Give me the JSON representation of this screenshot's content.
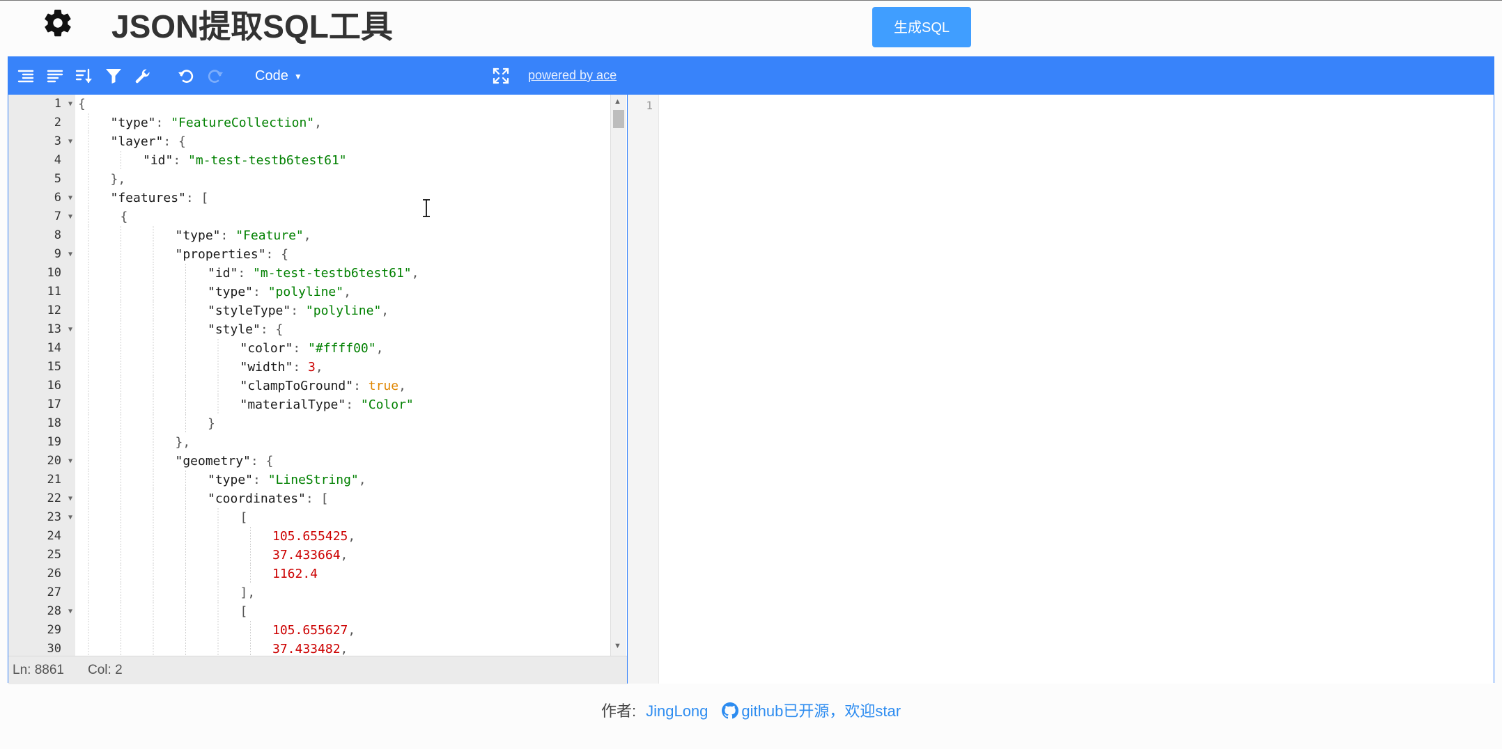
{
  "header": {
    "title": "JSON提取SQL工具",
    "generate_button": "生成SQL",
    "settings_icon": "gear-icon"
  },
  "toolbar": {
    "icons": [
      "expand-all-icon",
      "collapse-all-icon",
      "sort-icon",
      "filter-icon",
      "transform-wrench-icon",
      "undo-icon",
      "redo-icon"
    ],
    "mode_label": "Code",
    "fullscreen_icon": "fullscreen-icon",
    "powered_by": "powered by ace"
  },
  "left_editor": {
    "lines": [
      {
        "n": "1",
        "fold": true,
        "indent": 0,
        "parts": [
          [
            "p",
            "{"
          ]
        ]
      },
      {
        "n": "2",
        "fold": false,
        "indent": 1,
        "parts": [
          [
            "k",
            "\"type\""
          ],
          [
            "p",
            ": "
          ],
          [
            "s",
            "\"FeatureCollection\""
          ],
          [
            "p",
            ","
          ]
        ]
      },
      {
        "n": "3",
        "fold": true,
        "indent": 1,
        "parts": [
          [
            "k",
            "\"layer\""
          ],
          [
            "p",
            ": {"
          ]
        ]
      },
      {
        "n": "4",
        "fold": false,
        "indent": 2,
        "parts": [
          [
            "k",
            "\"id\""
          ],
          [
            "p",
            ": "
          ],
          [
            "s",
            "\"m-test-testb6test61\""
          ]
        ]
      },
      {
        "n": "5",
        "fold": false,
        "indent": 1,
        "parts": [
          [
            "p",
            "},"
          ]
        ]
      },
      {
        "n": "6",
        "fold": true,
        "indent": 1,
        "parts": [
          [
            "k",
            "\"features\""
          ],
          [
            "p",
            ": ["
          ]
        ]
      },
      {
        "n": "7",
        "fold": true,
        "indent": 1.3,
        "parts": [
          [
            "p",
            "{"
          ]
        ]
      },
      {
        "n": "8",
        "fold": false,
        "indent": 3,
        "parts": [
          [
            "k",
            "\"type\""
          ],
          [
            "p",
            ": "
          ],
          [
            "s",
            "\"Feature\""
          ],
          [
            "p",
            ","
          ]
        ]
      },
      {
        "n": "9",
        "fold": true,
        "indent": 3,
        "parts": [
          [
            "k",
            "\"properties\""
          ],
          [
            "p",
            ": {"
          ]
        ]
      },
      {
        "n": "10",
        "fold": false,
        "indent": 4,
        "parts": [
          [
            "k",
            "\"id\""
          ],
          [
            "p",
            ": "
          ],
          [
            "s",
            "\"m-test-testb6test61\""
          ],
          [
            "p",
            ","
          ]
        ]
      },
      {
        "n": "11",
        "fold": false,
        "indent": 4,
        "parts": [
          [
            "k",
            "\"type\""
          ],
          [
            "p",
            ": "
          ],
          [
            "s",
            "\"polyline\""
          ],
          [
            "p",
            ","
          ]
        ]
      },
      {
        "n": "12",
        "fold": false,
        "indent": 4,
        "parts": [
          [
            "k",
            "\"styleType\""
          ],
          [
            "p",
            ": "
          ],
          [
            "s",
            "\"polyline\""
          ],
          [
            "p",
            ","
          ]
        ]
      },
      {
        "n": "13",
        "fold": true,
        "indent": 4,
        "parts": [
          [
            "k",
            "\"style\""
          ],
          [
            "p",
            ": {"
          ]
        ]
      },
      {
        "n": "14",
        "fold": false,
        "indent": 5,
        "parts": [
          [
            "k",
            "\"color\""
          ],
          [
            "p",
            ": "
          ],
          [
            "s",
            "\"#ffff00\""
          ],
          [
            "p",
            ","
          ]
        ]
      },
      {
        "n": "15",
        "fold": false,
        "indent": 5,
        "parts": [
          [
            "k",
            "\"width\""
          ],
          [
            "p",
            ": "
          ],
          [
            "n",
            "3"
          ],
          [
            "p",
            ","
          ]
        ]
      },
      {
        "n": "16",
        "fold": false,
        "indent": 5,
        "parts": [
          [
            "k",
            "\"clampToGround\""
          ],
          [
            "p",
            ": "
          ],
          [
            "b",
            "true"
          ],
          [
            "p",
            ","
          ]
        ]
      },
      {
        "n": "17",
        "fold": false,
        "indent": 5,
        "parts": [
          [
            "k",
            "\"materialType\""
          ],
          [
            "p",
            ": "
          ],
          [
            "s",
            "\"Color\""
          ]
        ]
      },
      {
        "n": "18",
        "fold": false,
        "indent": 4,
        "parts": [
          [
            "p",
            "}"
          ]
        ]
      },
      {
        "n": "19",
        "fold": false,
        "indent": 3,
        "parts": [
          [
            "p",
            "},"
          ]
        ]
      },
      {
        "n": "20",
        "fold": true,
        "indent": 3,
        "parts": [
          [
            "k",
            "\"geometry\""
          ],
          [
            "p",
            ": {"
          ]
        ]
      },
      {
        "n": "21",
        "fold": false,
        "indent": 4,
        "parts": [
          [
            "k",
            "\"type\""
          ],
          [
            "p",
            ": "
          ],
          [
            "s",
            "\"LineString\""
          ],
          [
            "p",
            ","
          ]
        ]
      },
      {
        "n": "22",
        "fold": true,
        "indent": 4,
        "parts": [
          [
            "k",
            "\"coordinates\""
          ],
          [
            "p",
            ": ["
          ]
        ]
      },
      {
        "n": "23",
        "fold": true,
        "indent": 5,
        "parts": [
          [
            "p",
            "["
          ]
        ]
      },
      {
        "n": "24",
        "fold": false,
        "indent": 6,
        "parts": [
          [
            "n",
            "105.655425"
          ],
          [
            "p",
            ","
          ]
        ]
      },
      {
        "n": "25",
        "fold": false,
        "indent": 6,
        "parts": [
          [
            "n",
            "37.433664"
          ],
          [
            "p",
            ","
          ]
        ]
      },
      {
        "n": "26",
        "fold": false,
        "indent": 6,
        "parts": [
          [
            "n",
            "1162.4"
          ]
        ]
      },
      {
        "n": "27",
        "fold": false,
        "indent": 5,
        "parts": [
          [
            "p",
            "],"
          ]
        ]
      },
      {
        "n": "28",
        "fold": true,
        "indent": 5,
        "parts": [
          [
            "p",
            "["
          ]
        ]
      },
      {
        "n": "29",
        "fold": false,
        "indent": 6,
        "parts": [
          [
            "n",
            "105.655627"
          ],
          [
            "p",
            ","
          ]
        ]
      },
      {
        "n": "30",
        "fold": false,
        "indent": 6,
        "parts": [
          [
            "n",
            "37.433482"
          ],
          [
            "p",
            ","
          ]
        ]
      }
    ],
    "status": {
      "ln": "Ln: 8861",
      "col": "Col: 2"
    }
  },
  "right_editor": {
    "line_number": "1"
  },
  "footer": {
    "author_label": "作者:",
    "author_name": "JingLong",
    "github_text": "github已开源，欢迎star",
    "github_icon": "github-icon"
  },
  "colors": {
    "accent": "#3883fa",
    "button": "#409eff",
    "string": "#008000",
    "number": "#cc0000",
    "boolean": "#e08600"
  }
}
